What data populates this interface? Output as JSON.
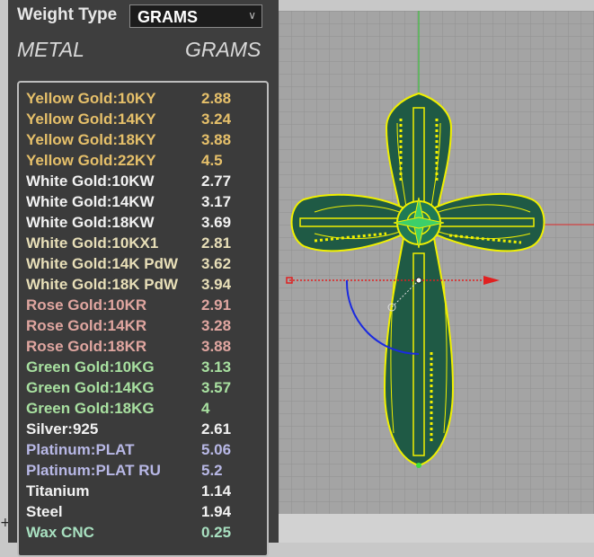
{
  "weight_type": {
    "label": "Weight Type",
    "selected": "GRAMS"
  },
  "headers": {
    "metal": "METAL",
    "grams": "GRAMS"
  },
  "colors": {
    "yellow": "#e6c06a",
    "white": "#f2f2f2",
    "white_alloy": "#e8dfb8",
    "rose": "#e0a6a0",
    "green": "#a8e0a0",
    "silver": "#f2f2f2",
    "platinum": "#b8b8e6",
    "wax": "#a8e0c0",
    "viewport_bg": "#a4a4a4",
    "grid_line": "#8f8f8f",
    "model_fill": "#1f5a45",
    "model_wire": "#f0f000"
  },
  "metals": [
    {
      "name": "Yellow Gold:10KY",
      "grams": "2.88",
      "color_key": "yellow"
    },
    {
      "name": "Yellow Gold:14KY",
      "grams": "3.24",
      "color_key": "yellow"
    },
    {
      "name": "Yellow Gold:18KY",
      "grams": "3.88",
      "color_key": "yellow"
    },
    {
      "name": "Yellow Gold:22KY",
      "grams": "4.5",
      "color_key": "yellow"
    },
    {
      "name": "White Gold:10KW",
      "grams": "2.77",
      "color_key": "white"
    },
    {
      "name": "White Gold:14KW",
      "grams": "3.17",
      "color_key": "white"
    },
    {
      "name": "White Gold:18KW",
      "grams": "3.69",
      "color_key": "white"
    },
    {
      "name": "White Gold:10KX1",
      "grams": "2.81",
      "color_key": "white_alloy"
    },
    {
      "name": "White Gold:14K PdW",
      "grams": "3.62",
      "color_key": "white_alloy"
    },
    {
      "name": "White Gold:18K PdW",
      "grams": "3.94",
      "color_key": "white_alloy"
    },
    {
      "name": "Rose Gold:10KR",
      "grams": "2.91",
      "color_key": "rose"
    },
    {
      "name": "Rose Gold:14KR",
      "grams": "3.28",
      "color_key": "rose"
    },
    {
      "name": "Rose Gold:18KR",
      "grams": "3.88",
      "color_key": "rose"
    },
    {
      "name": "Green Gold:10KG",
      "grams": "3.13",
      "color_key": "green"
    },
    {
      "name": "Green Gold:14KG",
      "grams": "3.57",
      "color_key": "green"
    },
    {
      "name": "Green Gold:18KG",
      "grams": "4",
      "color_key": "green"
    },
    {
      "name": "Silver:925",
      "grams": "2.61",
      "color_key": "silver"
    },
    {
      "name": "Platinum:PLAT",
      "grams": "5.06",
      "color_key": "platinum"
    },
    {
      "name": "Platinum:PLAT RU",
      "grams": "5.2",
      "color_key": "platinum"
    },
    {
      "name": "Titanium",
      "grams": "1.14",
      "color_key": "white"
    },
    {
      "name": "Steel",
      "grams": "1.94",
      "color_key": "white"
    },
    {
      "name": "Wax  CNC",
      "grams": "0.25",
      "color_key": "wax"
    }
  ],
  "icons": {
    "dropdown": "chevron-down-icon",
    "corner": "plus-icon"
  },
  "corner_glyph": "+"
}
